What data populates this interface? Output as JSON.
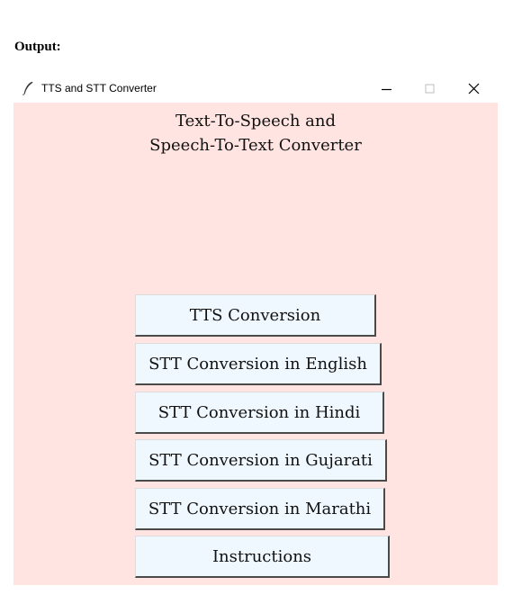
{
  "page_caption": "Output:",
  "window": {
    "title": "TTS and STT Converter",
    "controls": {
      "minimize": "—",
      "maximize": "☐",
      "close": "✕"
    }
  },
  "heading": {
    "line1": "Text-To-Speech and",
    "line2": "Speech-To-Text Converter"
  },
  "buttons": {
    "tts": "TTS Conversion",
    "stt_english": "STT Conversion in English",
    "stt_hindi": "STT Conversion in Hindi",
    "stt_gujarati": "STT Conversion in Gujarati",
    "stt_marathi": "STT Conversion in Marathi",
    "instructions": "Instructions"
  },
  "colors": {
    "background": "#ffe4e1",
    "button_face": "#f0f8ff"
  },
  "icons": {
    "app": "feather-icon"
  }
}
